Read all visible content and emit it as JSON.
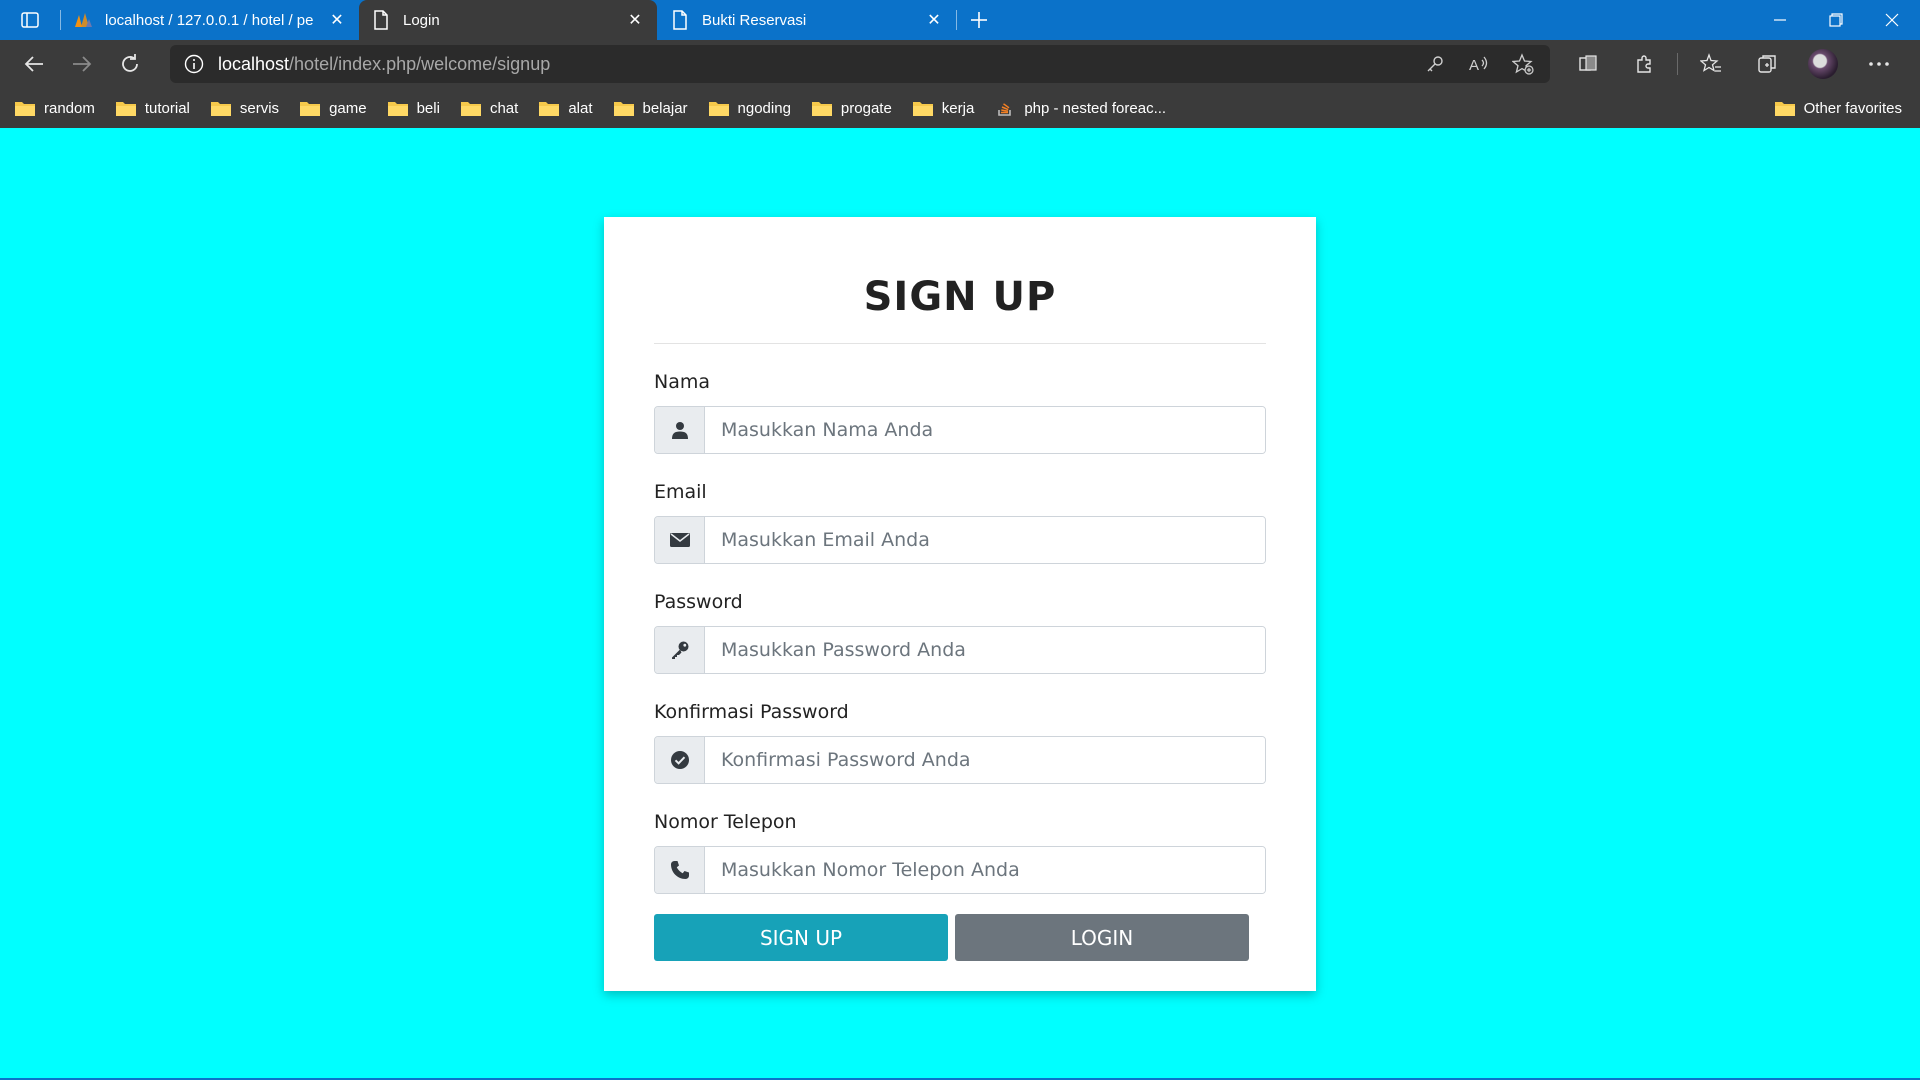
{
  "browser": {
    "tabs": [
      {
        "title": "localhost / 127.0.0.1 / hotel / pe",
        "icon": "phpmyadmin-icon",
        "active": false
      },
      {
        "title": "Login",
        "icon": "page-icon",
        "active": true
      },
      {
        "title": "Bukti Reservasi",
        "icon": "page-icon",
        "active": false
      }
    ],
    "address": {
      "host": "localhost",
      "path": "/hotel/index.php/welcome/signup"
    },
    "bookmarks": [
      "random",
      "tutorial",
      "servis",
      "game",
      "beli",
      "chat",
      "alat",
      "belajar",
      "ngoding",
      "progate",
      "kerja"
    ],
    "bookmark_link": "php - nested foreac...",
    "other_favorites": "Other favorites"
  },
  "form": {
    "title": "SIGN UP",
    "fields": [
      {
        "label": "Nama",
        "placeholder": "Masukkan Nama Anda",
        "icon": "user-icon"
      },
      {
        "label": "Email",
        "placeholder": "Masukkan Email Anda",
        "icon": "envelope-icon"
      },
      {
        "label": "Password",
        "placeholder": "Masukkan Password Anda",
        "icon": "key-icon"
      },
      {
        "label": "Konfirmasi Password",
        "placeholder": "Konfirmasi Password Anda",
        "icon": "check-circle-icon"
      },
      {
        "label": "Nomor Telepon",
        "placeholder": "Masukkan Nomor Telepon Anda",
        "icon": "phone-icon"
      }
    ],
    "signup_label": "SIGN UP",
    "login_label": "LOGIN"
  },
  "colors": {
    "page_background": "#00ffff",
    "signup_button": "#17a2b8",
    "login_button": "#6c757d",
    "tabbar": "#0b72c9"
  }
}
